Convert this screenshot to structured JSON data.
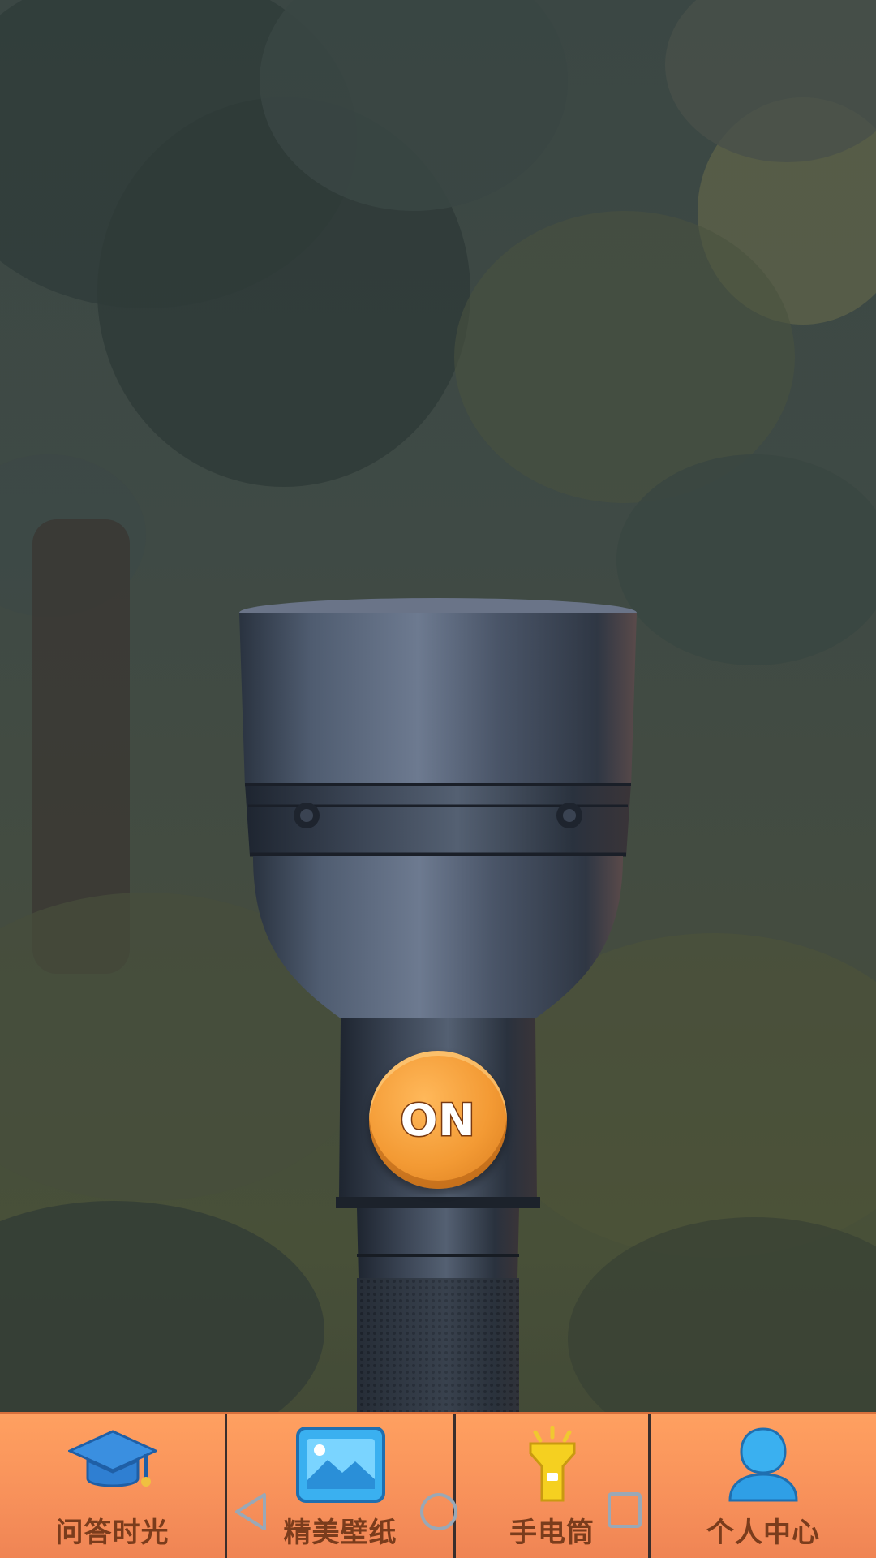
{
  "flashlight": {
    "button_label": "ON"
  },
  "nav": {
    "items": [
      {
        "label": "问答时光",
        "icon": "graduation-cap-icon"
      },
      {
        "label": "精美壁纸",
        "icon": "picture-icon"
      },
      {
        "label": "手电筒",
        "icon": "flashlight-icon"
      },
      {
        "label": "个人中心",
        "icon": "person-icon"
      }
    ]
  },
  "system_nav": {
    "icons": [
      "back-icon",
      "home-icon",
      "recents-icon"
    ]
  },
  "colors": {
    "nav_background": "#f7905a",
    "nav_label": "#7a3c1c",
    "button": "#f39a34"
  }
}
